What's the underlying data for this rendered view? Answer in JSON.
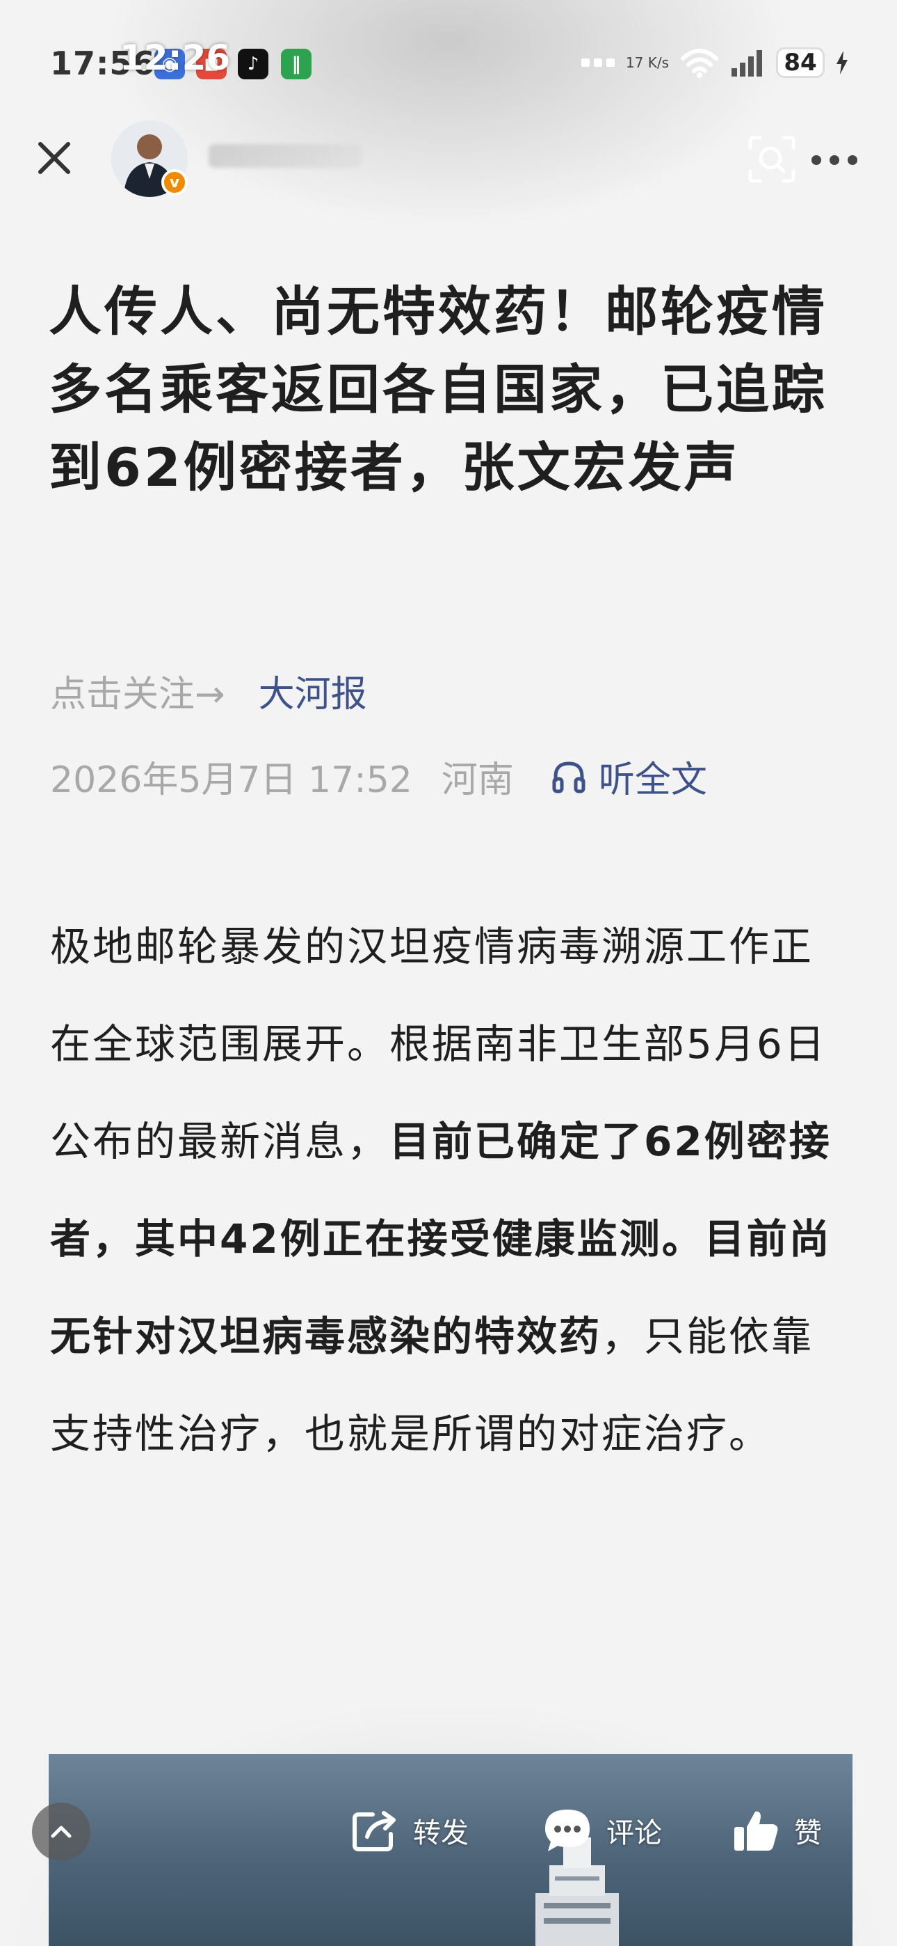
{
  "status_bar": {
    "time_behind": "17:56",
    "time_front": "12:26",
    "app_icons": [
      "browser-app-icon",
      "news-app-icon",
      "tiktok-app-icon",
      "green-app-icon"
    ],
    "net_speed": "17 K/s",
    "battery": "84"
  },
  "nav": {
    "verify_badge": "v"
  },
  "article": {
    "title": "人传人、尚无特效药！邮轮疫情多名乘客返回各自国家，已追踪到62例密接者，张文宏发声",
    "follow_label": "点击关注→",
    "source": "大河报",
    "date": "2026年5月7日 17:52",
    "location": "河南",
    "listen_label": "听全文",
    "body": {
      "p1": "极地邮轮暴发的汉坦疫情病毒溯源工作正在全球范围展开。根据南非卫生部5月6日公布的最新消息，",
      "p1_bold": "目前已确定了62例密接者，其中42例正在接受健康监测。目前尚无针对汉坦病毒感染的特效药",
      "p1_end": "，只能依靠支持性治疗，也就是所谓的对症治疗。"
    }
  },
  "bottom_bar": {
    "share_label": "转发",
    "comment_label": "评论",
    "like_label": "赞"
  }
}
